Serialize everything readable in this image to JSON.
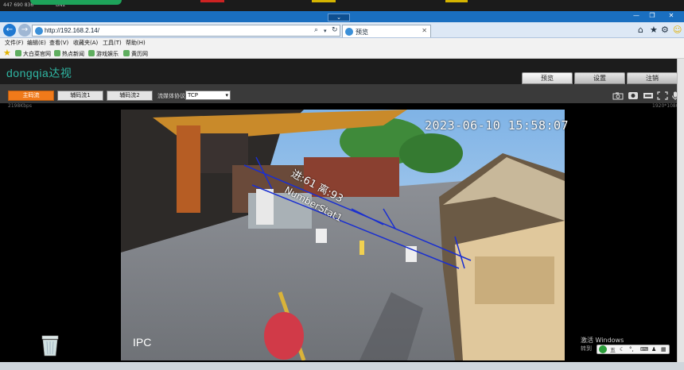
{
  "top_strip": {
    "left_text": "447 690 836",
    "tab_text": "BN2"
  },
  "window": {
    "minimize": "—",
    "restore": "❐",
    "close": "✕",
    "dropdown": "⌄"
  },
  "address_bar": {
    "url": "http://192.168.2.14/",
    "tab_title": "预览"
  },
  "menu": [
    "文件(F)",
    "编辑(E)",
    "查看(V)",
    "收藏夹(A)",
    "工具(T)",
    "帮助(H)"
  ],
  "favorites": [
    "大白菜官网",
    "热点新闻",
    "游戏娱乐",
    "黄历网"
  ],
  "app": {
    "logo": "dongqia达视",
    "tabs": [
      "预览",
      "设置",
      "注销"
    ]
  },
  "controls": {
    "main_stream": "主码流",
    "sub_stream_1": "辅码流1",
    "sub_stream_2": "辅码流2",
    "protocol_label": "流媒体协议",
    "protocol_value": "TCP"
  },
  "video": {
    "bitrate": "2198Kbps",
    "resolution": "1920*1080",
    "osd_time": "2023-06-10 15:58:07",
    "osd_channel": "IPC",
    "osd_count": "进:61 离:93",
    "osd_rule": "NumberStat1"
  },
  "watermark": {
    "line1": "激活 Windows",
    "line2": "转到"
  },
  "ime": {
    "label": "五"
  },
  "colors": {
    "accent_orange": "#f07a1a",
    "title_blue": "#1a6fc0",
    "logo_teal": "#2fb7a4",
    "rule_line": "#1a2fd0"
  }
}
